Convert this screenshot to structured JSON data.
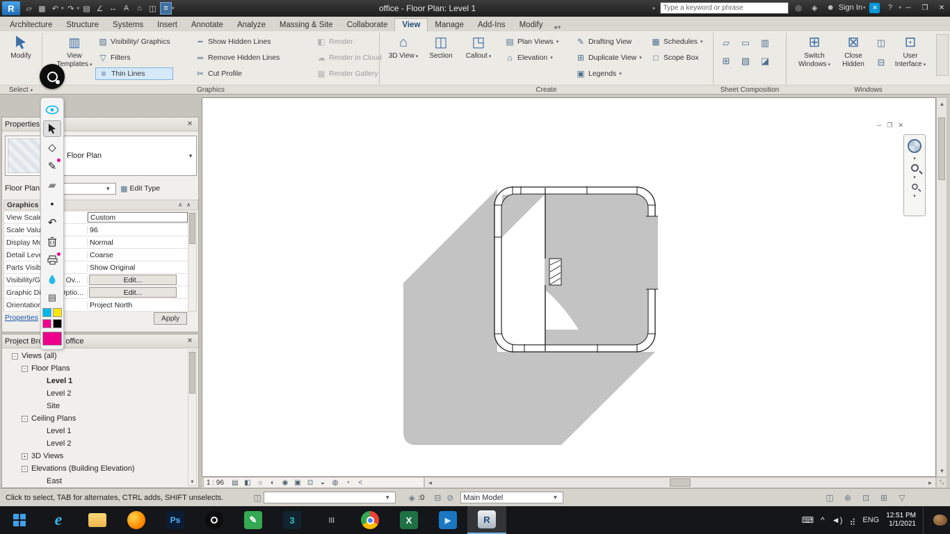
{
  "colors": {
    "accent_blue": "#3a79b8",
    "selection_highlight": "#d6e9f8",
    "shadow_gray": "#c3c3c3",
    "swatch_cyan": "#00b7eb",
    "swatch_yellow": "#ffe500",
    "swatch_magenta": "#ec008c",
    "swatch_black": "#000000"
  },
  "titlebar": {
    "app_logo": "R",
    "title": "office - Floor Plan: Level 1",
    "search_placeholder": "Type a keyword or phrase",
    "sign_in": "Sign In",
    "help": "?"
  },
  "tabs": {
    "items": [
      "Architecture",
      "Structure",
      "Systems",
      "Insert",
      "Annotate",
      "Analyze",
      "Massing & Site",
      "Collaborate",
      "View",
      "Manage",
      "Add-Ins",
      "Modify"
    ]
  },
  "ribbon": {
    "panels": {
      "select": "Select",
      "graphics": "Graphics",
      "create": "Create",
      "sheet": "Sheet Composition",
      "windows": "Windows"
    },
    "modify": "Modify",
    "view_templates": "View Templates",
    "visibility_graphics": "Visibility/ Graphics",
    "filters": "Filters",
    "thin_lines": "Thin Lines",
    "show_hidden_lines": "Show Hidden Lines",
    "remove_hidden_lines": "Remove Hidden Lines",
    "cut_profile": "Cut Profile",
    "render": "Render",
    "render_in_cloud": "Render in Cloud",
    "render_gallery": "Render Gallery",
    "view_3d": "3D View",
    "section": "Section",
    "callout": "Callout",
    "plan_views": "Plan Views",
    "elevation": "Elevation",
    "drafting_view": "Drafting View",
    "duplicate_view": "Duplicate View",
    "legends": "Legends",
    "schedules": "Schedules",
    "scope_box": "Scope Box",
    "switch_windows": "Switch Windows",
    "close_hidden": "Close Hidden",
    "user_interface": "User Interface"
  },
  "properties": {
    "title": "Properties",
    "type_selector": "Floor Plan",
    "instance_label": "Floor Plan",
    "edit_type": "Edit Type",
    "section_graphics": "Graphics",
    "rows": [
      {
        "label": "View Scale",
        "value": "Custom"
      },
      {
        "label": "Scale Value   1:",
        "value": "96"
      },
      {
        "label": "Display Model",
        "value": "Normal"
      },
      {
        "label": "Detail Level",
        "value": "Coarse"
      },
      {
        "label": "Parts Visibility",
        "value": "Show Original"
      },
      {
        "label": "Visibility/Graphics Ov...",
        "value": "Edit..."
      },
      {
        "label": "Graphic Display Optio...",
        "value": "Edit..."
      },
      {
        "label": "Orientation",
        "value": "Project North"
      }
    ],
    "apply": "Apply",
    "help_link": "Properties"
  },
  "browser": {
    "title": "Project Browser - office",
    "items": [
      {
        "label": "Views (all)"
      },
      {
        "label": "Floor Plans"
      },
      {
        "label": "Level 1"
      },
      {
        "label": "Level 2"
      },
      {
        "label": "Site"
      },
      {
        "label": "Ceiling Plans"
      },
      {
        "label": "Level 1"
      },
      {
        "label": "Level 2"
      },
      {
        "label": "3D Views"
      },
      {
        "label": "Elevations (Building Elevation)"
      },
      {
        "label": "East"
      }
    ]
  },
  "canvas": {
    "scale": "1 : 96"
  },
  "statusbar": {
    "hint": "Click to select, TAB for alternates, CTRL adds, SHIFT unselects.",
    "design_options": ":0",
    "main_model": "Main Model"
  },
  "taskbar": {
    "language": "ENG",
    "time": "12:51 PM",
    "date": "1/1/2021",
    "ie_glyph": "e",
    "photoshop_glyph": "Ps",
    "max_glyph": "3",
    "excel_glyph": "X",
    "revit_glyph": "R"
  }
}
